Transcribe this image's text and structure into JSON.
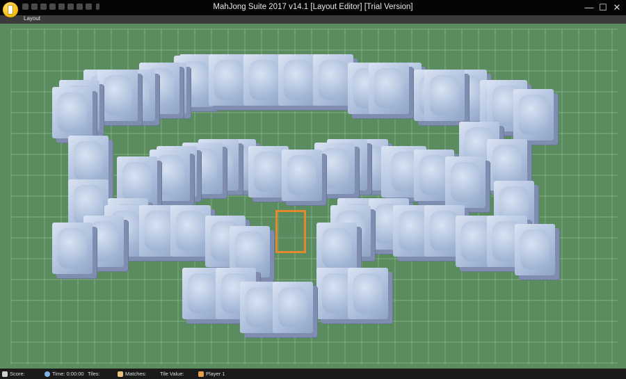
{
  "window": {
    "title": "MahJong Suite 2017 v14.1  [Layout Editor]  [Trial Version]",
    "controls": {
      "minimize": "—",
      "maximize": "☐",
      "close": "✕"
    }
  },
  "quick_access": [
    "new-icon",
    "open-icon",
    "undo-icon",
    "redo-icon",
    "grid-icon",
    "chart-icon",
    "tools-icon",
    "help-icon",
    "dropdown-icon"
  ],
  "menu": {
    "items": [
      "Layout"
    ]
  },
  "board": {
    "background": "#5b8c5f",
    "grid_color": "#7fae83",
    "selection_color": "#e08a2c"
  },
  "status": {
    "score_label": "Score:",
    "time_label": "Time: 0:00:00",
    "tiles_label": "Tiles:",
    "matches_label": "Matches:",
    "tile_value_label": "Tile Value:",
    "player_label": "Player 1"
  }
}
